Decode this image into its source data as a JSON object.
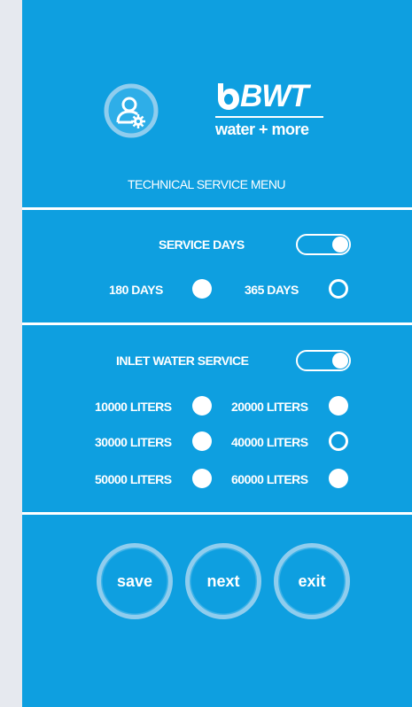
{
  "header": {
    "logo_text": "BWT",
    "logo_tagline": "water + more",
    "title": "TECHNICAL SERVICE MENU"
  },
  "icons": {
    "user_settings": "user-settings-icon",
    "brand_logo": "bwt-drop-logo"
  },
  "service_days": {
    "label": "SERVICE DAYS",
    "enabled": true,
    "options": [
      {
        "label": "180 DAYS",
        "selected": false
      },
      {
        "label": "365 DAYS",
        "selected": true
      }
    ]
  },
  "inlet_water": {
    "label": "INLET WATER SERVICE",
    "enabled": true,
    "options": [
      {
        "label": "10000 LITERS",
        "selected": false
      },
      {
        "label": "20000 LITERS",
        "selected": false
      },
      {
        "label": "30000 LITERS",
        "selected": false
      },
      {
        "label": "40000 LITERS",
        "selected": true
      },
      {
        "label": "50000 LITERS",
        "selected": false
      },
      {
        "label": "60000 LITERS",
        "selected": false
      }
    ]
  },
  "actions": {
    "save": "save",
    "next": "next",
    "exit": "exit"
  },
  "colors": {
    "panel": "#0e9fe0",
    "page_background": "#e6e9ef",
    "foreground": "#ffffff",
    "button_ring": "#8fcdee"
  }
}
